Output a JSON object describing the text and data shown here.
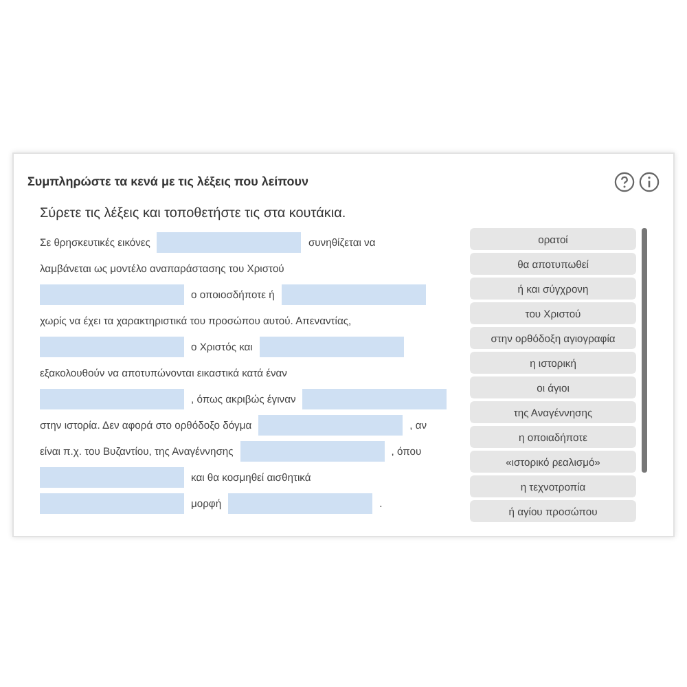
{
  "title": "Συμπληρώστε τα κενά με τις λέξεις που λείπουν",
  "instruction": "Σύρετε τις λέξεις και τοποθετήστε τις στα κουτάκια.",
  "lines": [
    [
      {
        "kind": "text",
        "text": "Σε θρησκευτικές εικόνες"
      },
      {
        "kind": "blank"
      },
      {
        "kind": "text",
        "text": "συνηθίζεται να"
      }
    ],
    [
      {
        "kind": "text",
        "text": "λαμβάνεται ως μοντέλο αναπαράστασης του Χριστού"
      }
    ],
    [
      {
        "kind": "blank"
      },
      {
        "kind": "text",
        "text": "ο οποιοσδήποτε ή"
      },
      {
        "kind": "blank"
      }
    ],
    [
      {
        "kind": "text",
        "text": "χωρίς να έχει τα χαρακτηριστικά του προσώπου αυτού. Απεναντίας,"
      }
    ],
    [
      {
        "kind": "blank"
      },
      {
        "kind": "text",
        "text": "ο Χριστός και"
      },
      {
        "kind": "blank"
      }
    ],
    [
      {
        "kind": "text",
        "text": "εξακολουθούν να αποτυπώνονται εικαστικά κατά έναν"
      }
    ],
    [
      {
        "kind": "blank"
      },
      {
        "kind": "text",
        "text": ", όπως ακριβώς έγιναν"
      },
      {
        "kind": "blank"
      }
    ],
    [
      {
        "kind": "text",
        "text": "στην ιστορία. Δεν αφορά στο ορθόδοξο δόγμα"
      },
      {
        "kind": "blank"
      },
      {
        "kind": "text",
        "text": ", αν"
      }
    ],
    [
      {
        "kind": "text",
        "text": "είναι π.χ. του Βυζαντίου, της Αναγέννησης"
      },
      {
        "kind": "blank"
      },
      {
        "kind": "text",
        "text": ", όπου"
      }
    ],
    [
      {
        "kind": "blank"
      },
      {
        "kind": "text",
        "text": "και θα κοσμηθεί αισθητικά"
      }
    ],
    [
      {
        "kind": "blank"
      },
      {
        "kind": "text",
        "text": "μορφή"
      },
      {
        "kind": "blank"
      },
      {
        "kind": "text",
        "text": "."
      }
    ]
  ],
  "words": [
    "ορατοί",
    "θα αποτυπωθεί",
    "ή και σύγχρονη",
    "του Χριστού",
    "στην ορθόδοξη αγιογραφία",
    "η ιστορική",
    "οι άγιοι",
    "της Αναγέννησης",
    "η οποιαδήποτε",
    "«ιστορικό ρεαλισμό»",
    "η τεχνοτροπία",
    "ή αγίου προσώπου"
  ]
}
